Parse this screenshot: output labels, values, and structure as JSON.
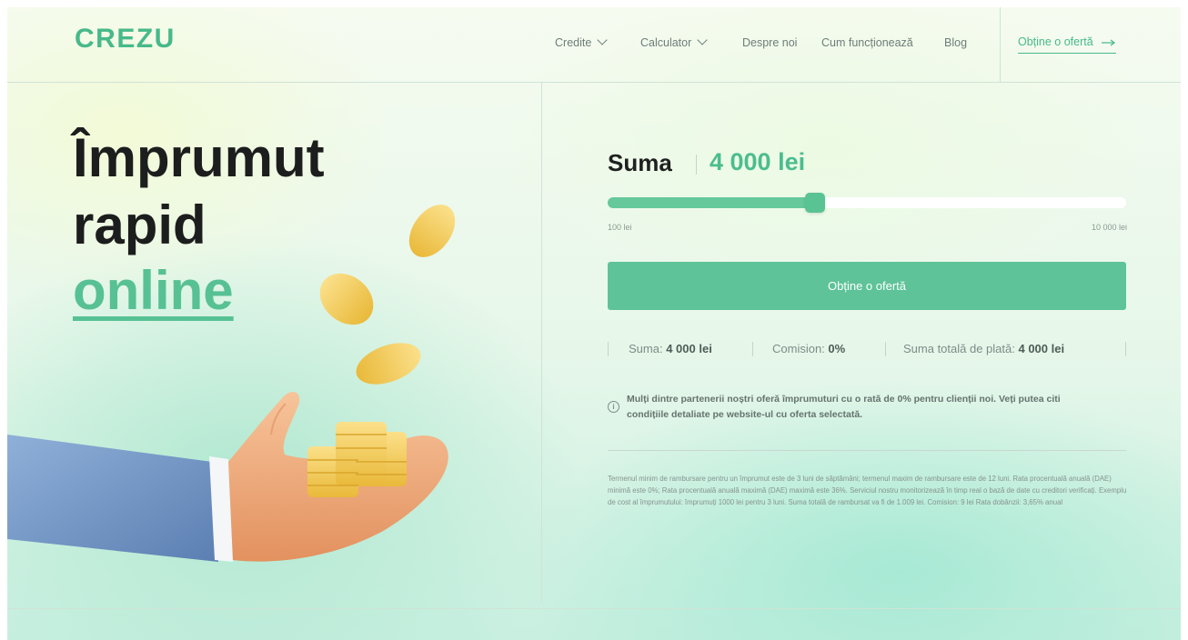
{
  "brand": {
    "logo_text": "CREZU",
    "accent_color": "#5ec398"
  },
  "nav": {
    "items": [
      {
        "label": "Credite",
        "has_dropdown": true
      },
      {
        "label": "Calculator",
        "has_dropdown": true
      },
      {
        "label": "Despre noi",
        "has_dropdown": false
      },
      {
        "label": "Cum funcționează",
        "has_dropdown": false
      },
      {
        "label": "Blog",
        "has_dropdown": false
      }
    ],
    "cta_label": "Obține o ofertă",
    "cta_icon": "arrow-right-icon"
  },
  "hero": {
    "title_line1": "Împrumut",
    "title_line2": "rapid",
    "title_line3": "online"
  },
  "calculator": {
    "amount_label": "Suma",
    "amount_value": "4 000 lei",
    "slider": {
      "min_label": "100 lei",
      "max_label": "10 000 lei",
      "fill_fraction": 0.4
    },
    "cta_label": "Obține o ofertă",
    "summary": {
      "amount_label": "Suma:",
      "amount_value": "4 000 lei",
      "commission_label": "Comision:",
      "commission_value": "0%",
      "total_label": "Suma totală de plată:",
      "total_value": "4 000 lei"
    },
    "info_icon": "info-icon",
    "info_text": "Mulți dintre partenerii noștri oferă împrumuturi cu o rată de 0% pentru clienții noi. Veți putea citi condițiile detaliate pe website-ul cu oferta selectată.",
    "disclaimer": "Termenul minim de rambursare pentru un împrumut este de 3 luni de săptămâni; termenul maxim de rambursare este de 12 luni. Rata procentuală anuală (DAE) minimă este 0%; Rata procentuală anuală maximă (DAE) maximă este 36%. Serviciul nostru monitorizează în timp real o bază de date cu creditori verificați. Exemplu de cost al împrumutului: împrumuți 1000 lei pentru 3 luni. Suma totală de rambursat va fi de 1.009 lei. Comision: 9 lei Rata dobânzii: 3,65% anual"
  }
}
